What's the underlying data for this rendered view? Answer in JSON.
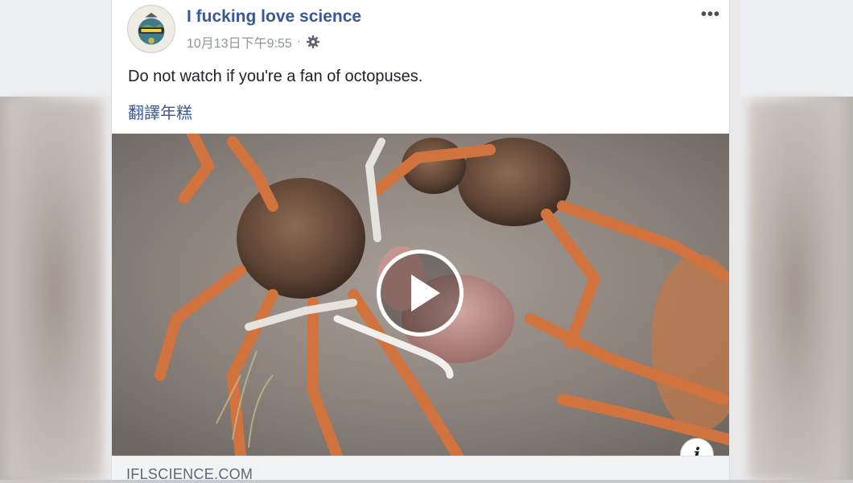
{
  "post": {
    "page_name": "I fucking love science",
    "timestamp": "10月13日下午9:55",
    "separator": "·",
    "text": "Do not watch if you're a fan of octopuses.",
    "translate_label": "翻譯年糕",
    "more_label": "•••"
  },
  "video": {
    "info_label": "i"
  },
  "link": {
    "domain": "IFLSCIENCE.COM"
  },
  "colors": {
    "link_blue": "#385898",
    "meta_gray": "#90949c",
    "text": "#1d2129"
  },
  "icons": {
    "gear": "gear-icon",
    "play": "play-icon",
    "more": "more-options-icon",
    "info": "info-icon"
  }
}
